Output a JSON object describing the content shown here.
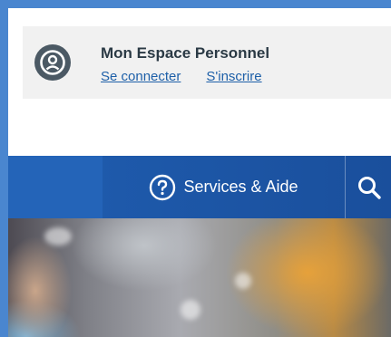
{
  "account": {
    "title": "Mon Espace Personnel",
    "login_label": "Se connecter",
    "register_label": "S'inscrire",
    "avatar_icon": "user-circle-icon"
  },
  "nav": {
    "services_label": "Services & Aide",
    "help_icon": "question-circle-icon",
    "search_icon": "search-icon"
  },
  "colors": {
    "frame": "#4a86cf",
    "nav_bar": "#1f5db0",
    "link": "#1d5fa8",
    "account_box": "#f1f1f1"
  }
}
